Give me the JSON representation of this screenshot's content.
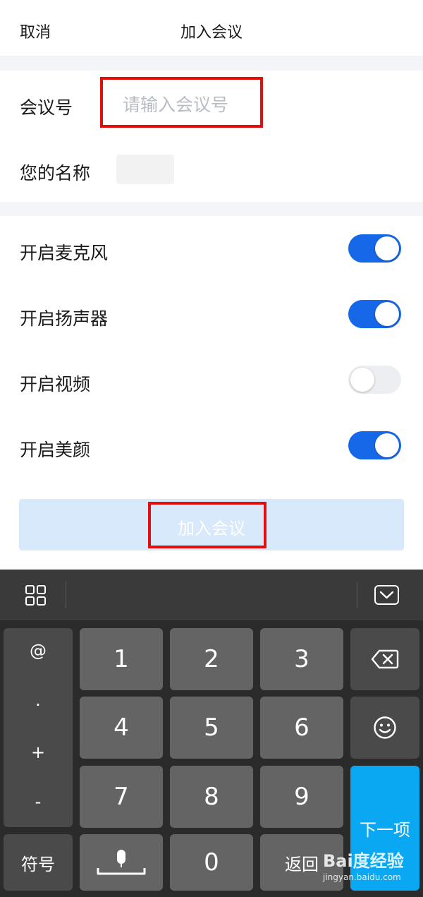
{
  "header": {
    "cancel_label": "取消",
    "title": "加入会议"
  },
  "form": {
    "meeting_id_label": "会议号",
    "meeting_id_placeholder": "请输入会议号",
    "meeting_id_value": "",
    "name_label": "您的名称"
  },
  "settings": [
    {
      "label": "开启麦克风",
      "on": true
    },
    {
      "label": "开启扬声器",
      "on": true
    },
    {
      "label": "开启视频",
      "on": false
    },
    {
      "label": "开启美颜",
      "on": true
    }
  ],
  "join_button_label": "加入会议",
  "keyboard": {
    "side_symbols": [
      "@",
      ".",
      "+",
      "-"
    ],
    "keys": [
      "1",
      "2",
      "3",
      "4",
      "5",
      "6",
      "7",
      "8",
      "9",
      "0"
    ],
    "symbol_label": "符号",
    "return_label": "返回",
    "next_label": "下一项"
  },
  "watermark": {
    "brand": "Bai度经验",
    "url": "jingyan.baidu.com"
  },
  "colors": {
    "accent": "#1768e8",
    "highlight": "#e30d0d",
    "key_blue": "#0aa8f3"
  }
}
